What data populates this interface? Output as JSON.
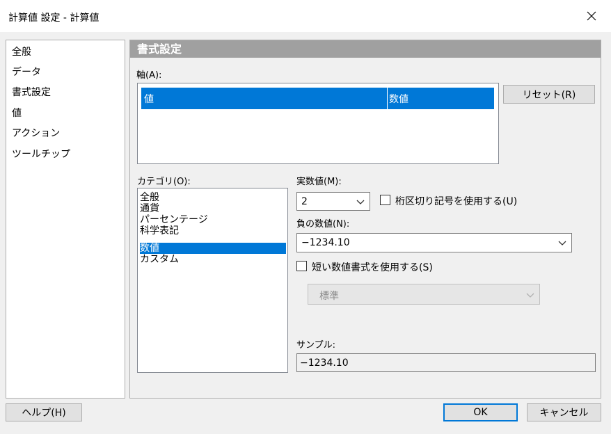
{
  "window": {
    "title": "計算値 設定 - 計算値"
  },
  "nav": {
    "items": [
      "全般",
      "データ",
      "書式設定",
      "値",
      "アクション",
      "ツールチップ"
    ]
  },
  "section": {
    "header": "書式設定"
  },
  "axis": {
    "label": "軸(A):",
    "rows": [
      {
        "name": "値",
        "type": "数値"
      }
    ],
    "reset_label": "リセット(R)"
  },
  "category": {
    "label": "カテゴリ(O):",
    "items": [
      "全般",
      "通貨",
      "パーセンテージ",
      "科学表記",
      "数値",
      "カスタム"
    ],
    "selected": "数値"
  },
  "real": {
    "label": "実数値(M):",
    "value": "2",
    "thousands_label": "桁区切り記号を使用する(U)",
    "thousands_checked": false
  },
  "negative": {
    "label": "負の数値(N):",
    "value": "−1234.10"
  },
  "short_format": {
    "label": "短い数値書式を使用する(S)",
    "checked": false,
    "value": "標準"
  },
  "sample": {
    "label": "サンプル:",
    "value": "−1234.10"
  },
  "footer": {
    "help_label": "ヘルプ(H)",
    "ok_label": "OK",
    "cancel_label": "キャンセル"
  },
  "colors": {
    "accent": "#0078d7",
    "header_bg": "#a0a0a0",
    "dialog_bg": "#f0f0f0"
  }
}
